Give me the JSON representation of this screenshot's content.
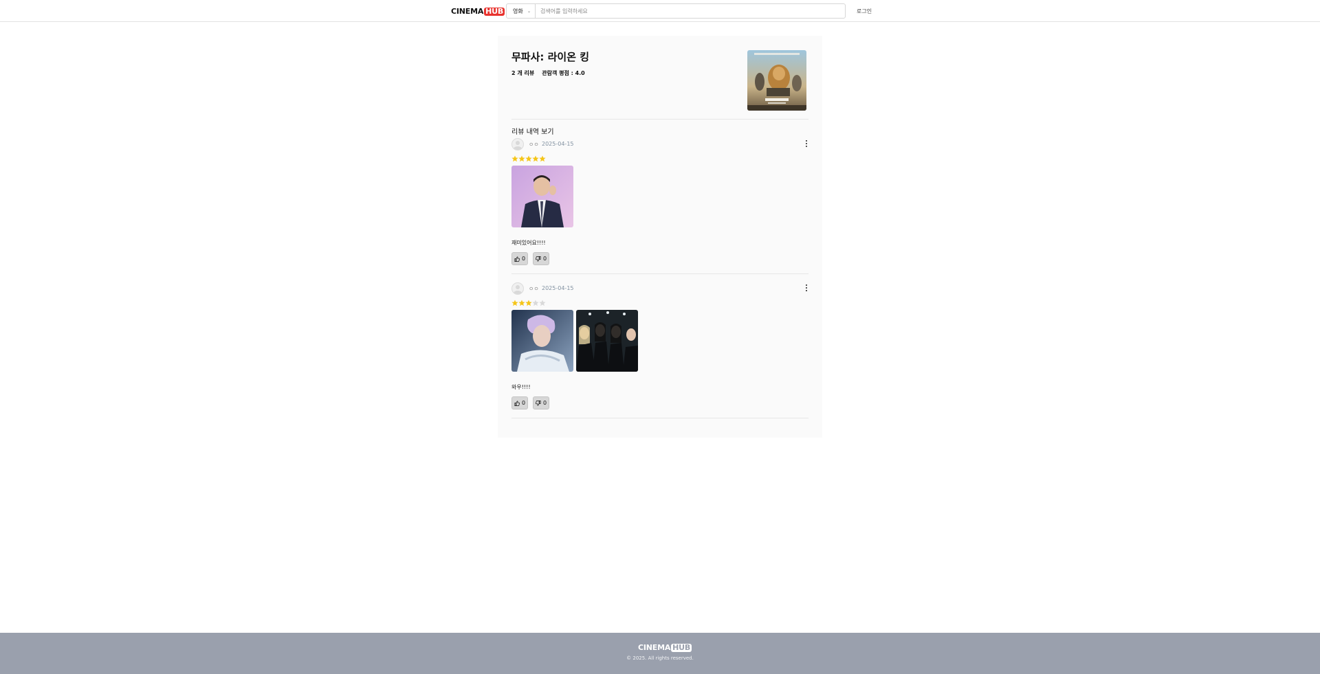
{
  "header": {
    "logo_main": "CINEMA",
    "logo_accent": "HUB",
    "category": "영화",
    "search_placeholder": "검색어를 입력하세요",
    "login_label": "로그인"
  },
  "movie": {
    "title": "무파사: 라이온 킹",
    "review_count": "2 개 리뷰",
    "audience_rating": "관람객 평점 : 4.0"
  },
  "section_title": "리뷰 내역 보기",
  "reviews": [
    {
      "username": "ㅇㅇ",
      "date": "2025-04-15",
      "rating": 5,
      "text": "재미있어요!!!!",
      "likes": "0",
      "dislikes": "0",
      "photo_count": 1
    },
    {
      "username": "ㅇㅇ",
      "date": "2025-04-15",
      "rating": 3,
      "text": "와우!!!!",
      "likes": "0",
      "dislikes": "0",
      "photo_count": 2
    }
  ],
  "footer": {
    "logo_main": "CINEMA",
    "logo_accent": "HUB",
    "copyright": "© 2025. All rights reserved."
  },
  "colors": {
    "accent": "#e8332e",
    "star_on": "#f5c518",
    "star_off": "#d9d9d9",
    "footer_bg": "#9aa0ad"
  }
}
